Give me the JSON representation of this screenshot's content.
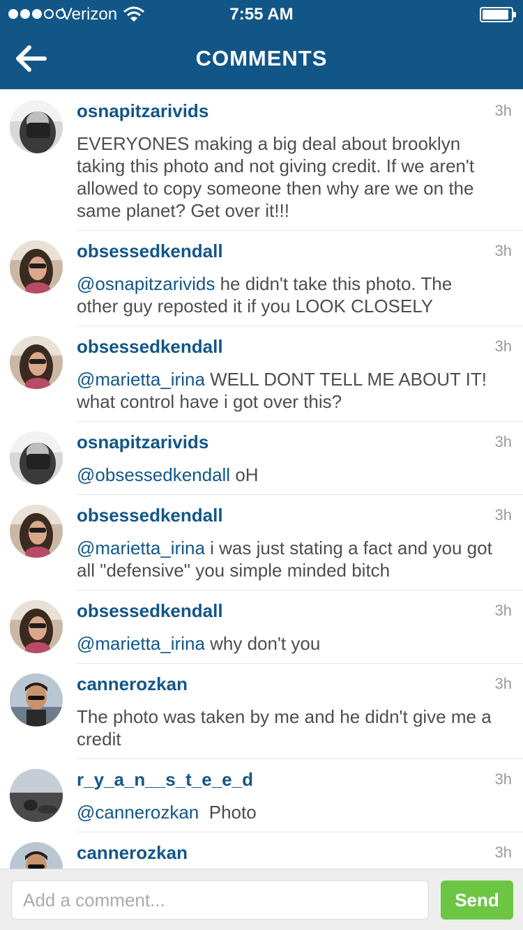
{
  "status_bar": {
    "carrier": "Verizon",
    "time": "7:55 AM",
    "signal_bars_filled": 3,
    "signal_bars_total": 5,
    "battery_level": 0.92
  },
  "header": {
    "title": "COMMENTS",
    "back_icon": "back-arrow-icon"
  },
  "colors": {
    "header_bg": "#125688",
    "username": "#125688",
    "send_button": "#6cc644"
  },
  "comments": [
    {
      "username": "osnapitzarivids",
      "age": "3h",
      "mention": "",
      "text": "EVERYONES making a big deal about brooklyn taking this photo and not giving credit. If we aren't allowed to copy someone then why are we on the same planet? Get over it!!!",
      "avatar": "avatar-bw-mask"
    },
    {
      "username": "obsessedkendall",
      "age": "3h",
      "mention": "@osnapitzarivids",
      "text": " he didn't take this photo. The other guy reposted it if you LOOK CLOSELY",
      "avatar": "avatar-girl-sunglasses"
    },
    {
      "username": "obsessedkendall",
      "age": "3h",
      "mention": "@marietta_irina",
      "text": " WELL DONT TELL ME ABOUT IT! what control have i got over this?",
      "avatar": "avatar-girl-sunglasses"
    },
    {
      "username": "osnapitzarivids",
      "age": "3h",
      "mention": "@obsessedkendall",
      "text": " oH",
      "avatar": "avatar-bw-mask"
    },
    {
      "username": "obsessedkendall",
      "age": "3h",
      "mention": "@marietta_irina",
      "text": " i was just stating a fact and you got all \"defensive\" you simple minded bitch",
      "avatar": "avatar-girl-sunglasses"
    },
    {
      "username": "obsessedkendall",
      "age": "3h",
      "mention": "@marietta_irina",
      "text": " why don't you",
      "avatar": "avatar-girl-sunglasses"
    },
    {
      "username": "cannerozkan",
      "age": "3h",
      "mention": "",
      "text": "The photo was taken by me and he didn't give me a credit",
      "avatar": "avatar-man-sunglasses"
    },
    {
      "username": "r_y_a_n__s_t_e_e_d",
      "age": "3h",
      "mention": "@cannerozkan",
      "text": "  Photo",
      "avatar": "avatar-coast-landscape"
    },
    {
      "username": "cannerozkan",
      "age": "3h",
      "mention": "",
      "text": "",
      "avatar": "avatar-man-sunglasses"
    }
  ],
  "composer": {
    "placeholder": "Add a comment...",
    "send_label": "Send"
  }
}
